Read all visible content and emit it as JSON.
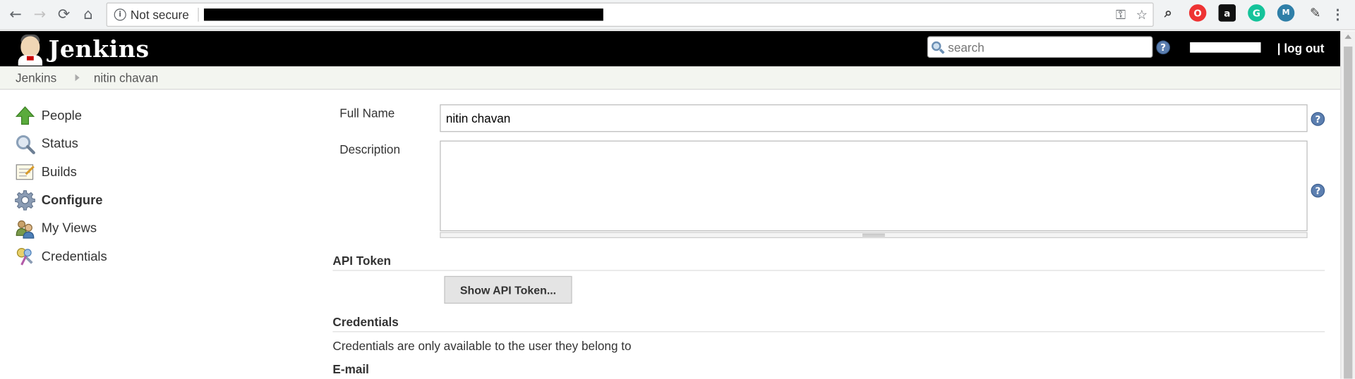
{
  "browser": {
    "security_label": "Not secure",
    "nav": {
      "back_icon": "←",
      "forward_icon": "→",
      "reload_icon": "⟳",
      "home_icon": "⌂"
    },
    "omnibox_icons": {
      "key_icon": "⚿",
      "star_icon": "☆"
    },
    "menu_icon": "⋮"
  },
  "jenkins": {
    "brand": "Jenkins",
    "search_placeholder": "search",
    "help_glyph": "?",
    "logout_label": "| log out"
  },
  "breadcrumb": {
    "root": "Jenkins",
    "current": "nitin chavan"
  },
  "sidebar": {
    "items": [
      {
        "label": "People",
        "icon": "up-arrow-icon",
        "active": false
      },
      {
        "label": "Status",
        "icon": "magnifier-icon",
        "active": false
      },
      {
        "label": "Builds",
        "icon": "notepad-icon",
        "active": false
      },
      {
        "label": "Configure",
        "icon": "gear-icon",
        "active": true
      },
      {
        "label": "My Views",
        "icon": "user-group-icon",
        "active": false
      },
      {
        "label": "Credentials",
        "icon": "keys-icon",
        "active": false
      }
    ]
  },
  "form": {
    "full_name_label": "Full Name",
    "full_name_value": "nitin chavan",
    "description_label": "Description",
    "description_value": "",
    "api_token_heading": "API Token",
    "show_api_token_button": "Show API Token...",
    "credentials_heading": "Credentials",
    "credentials_text": "Credentials are only available to the user they belong to",
    "email_heading": "E-mail"
  },
  "colors": {
    "header_bg": "#000000",
    "breadcrumb_bg": "#f3f5f0",
    "help_icon": "#5c7fb0"
  }
}
